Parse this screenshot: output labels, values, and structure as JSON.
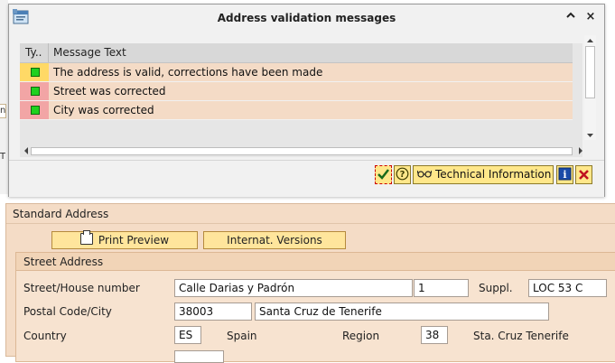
{
  "dialog": {
    "title": "Address validation messages",
    "minimize_glyph": "^",
    "close_glyph": "×",
    "columns": {
      "type": "Ty..",
      "message": "Message Text"
    },
    "rows": [
      {
        "message": "The address is valid, corrections have been made",
        "status_color": "#1fd11f",
        "row_bg": "#f4dbc6",
        "type_bg": "#ffd966"
      },
      {
        "message": "Street was corrected",
        "status_color": "#1fd11f",
        "row_bg": "#f4dbc6",
        "type_bg": "#f2a5a5"
      },
      {
        "message": "City was corrected",
        "status_color": "#1fd11f",
        "row_bg": "#f4dbc6",
        "type_bg": "#f2a5a5"
      }
    ],
    "footer": {
      "continue_icon": "check-icon",
      "help_icon": "help-icon",
      "technical_info_label": "Technical Information",
      "info_icon": "info-icon",
      "cancel_icon": "cancel-x-icon"
    }
  },
  "background_screen": {
    "left_edge_chars": [
      "n",
      "T"
    ],
    "section_title": "Standard Address",
    "buttons": {
      "print_preview": "Print Preview",
      "internat_versions": "Internat. Versions"
    },
    "group_title": "Street Address",
    "labels": {
      "street": "Street/House number",
      "postal": "Postal Code/City",
      "country": "Country",
      "suppl": "Suppl.",
      "region": "Region"
    },
    "values": {
      "street": "Calle Darias y Padrón",
      "house_number": "1",
      "suppl": "LOC 53 C",
      "postal_code": "38003",
      "city": "Santa Cruz de Tenerife",
      "country_code": "ES",
      "country_name": "Spain",
      "region_code": "38",
      "region_name": "Sta. Cruz Tenerife"
    }
  }
}
